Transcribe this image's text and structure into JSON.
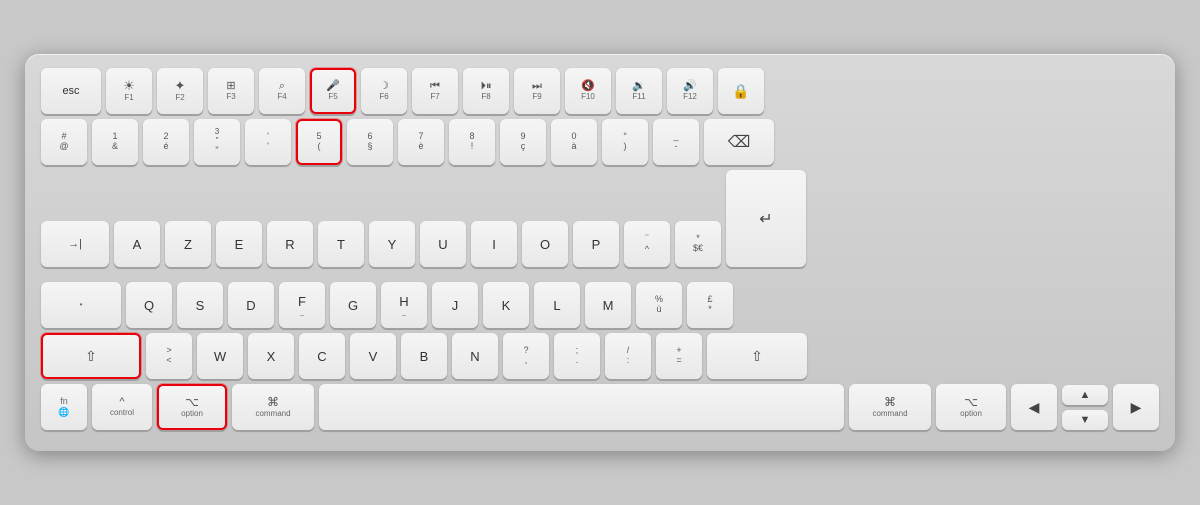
{
  "keyboard": {
    "rows": {
      "row1": {
        "keys": [
          {
            "id": "esc",
            "label": "esc",
            "size": "esc"
          },
          {
            "id": "f1",
            "top": "☀",
            "bottom": "F1",
            "size": "fn"
          },
          {
            "id": "f2",
            "top": "☀",
            "bottom": "F2",
            "size": "fn"
          },
          {
            "id": "f3",
            "top": "⧉",
            "bottom": "F3",
            "size": "fn"
          },
          {
            "id": "f4",
            "top": "🔍",
            "bottom": "F4",
            "size": "fn"
          },
          {
            "id": "f5",
            "top": "🎤",
            "bottom": "F5",
            "size": "fn"
          },
          {
            "id": "f6",
            "top": "☾",
            "bottom": "F6",
            "size": "fn"
          },
          {
            "id": "f7",
            "top": "⏮",
            "bottom": "F7",
            "size": "fn"
          },
          {
            "id": "f8",
            "top": "⏯",
            "bottom": "F8",
            "size": "fn"
          },
          {
            "id": "f9",
            "top": "⏭",
            "bottom": "F9",
            "size": "fn"
          },
          {
            "id": "f10",
            "top": "🔇",
            "bottom": "F10",
            "size": "fn"
          },
          {
            "id": "f11",
            "top": "🔉",
            "bottom": "F11",
            "size": "fn"
          },
          {
            "id": "f12",
            "top": "🔊",
            "bottom": "F12",
            "size": "fn"
          },
          {
            "id": "lock",
            "top": "🔒",
            "bottom": "",
            "size": "lock"
          }
        ]
      }
    },
    "highlighted_keys": [
      "f5-key",
      "shift-left-key",
      "option-left-key"
    ]
  }
}
